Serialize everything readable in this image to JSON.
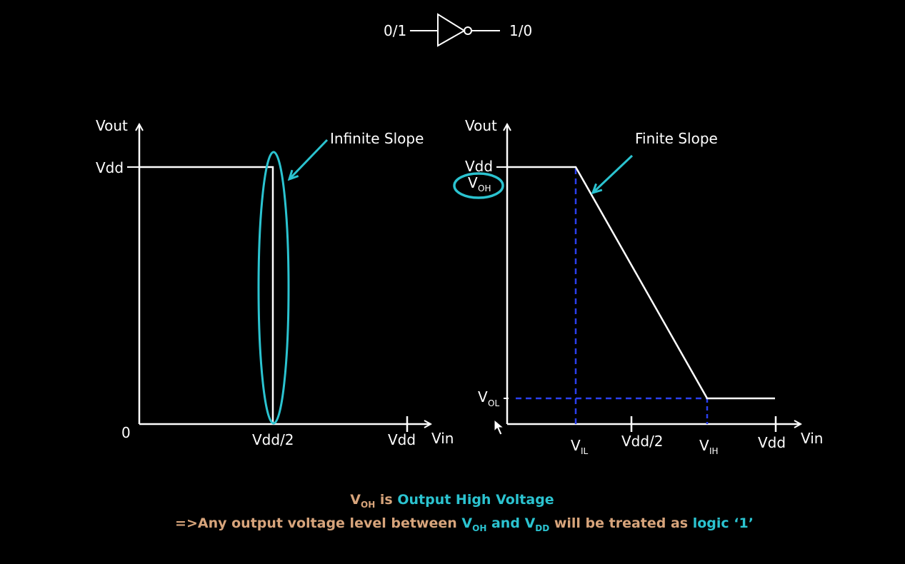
{
  "colors": {
    "background": "#000000",
    "line": "#ffffff",
    "highlight": "#2bc3d0",
    "guide": "#2b3ff0",
    "caption_text": "#d7a47b",
    "caption_accent": "#2bc3d0"
  },
  "inverter": {
    "input_label": "0/1",
    "output_label": "1/0"
  },
  "left_graph": {
    "y_axis_label": "Vout",
    "x_axis_label": "Vin",
    "vdd_tick_label": "Vdd",
    "origin_label": "0",
    "mid_tick_label": "Vdd/2",
    "end_tick_label": "Vdd",
    "annotation": "Infinite Slope"
  },
  "right_graph": {
    "y_axis_label": "Vout",
    "x_axis_label": "Vin",
    "vdd_tick_label": "Vdd",
    "voh": {
      "main": "V",
      "sub": "OH"
    },
    "vol": {
      "main": "V",
      "sub": "OL"
    },
    "vil": {
      "main": "V",
      "sub": "IL"
    },
    "vih": {
      "main": "V",
      "sub": "IH"
    },
    "mid_tick_label": "Vdd/2",
    "end_tick_label": "Vdd",
    "annotation": "Finite Slope"
  },
  "caption": {
    "line1": {
      "v": "V",
      "v_sub": "OH",
      "is": " is ",
      "accent": "Output High Voltage"
    },
    "line2": {
      "prefix": "=>Any output voltage level between ",
      "v1": "V",
      "v1_sub": "OH",
      "and": " and ",
      "v2": "V",
      "v2_sub": "DD",
      "middle": " will be treated as ",
      "accent": "logic ‘1’"
    }
  }
}
